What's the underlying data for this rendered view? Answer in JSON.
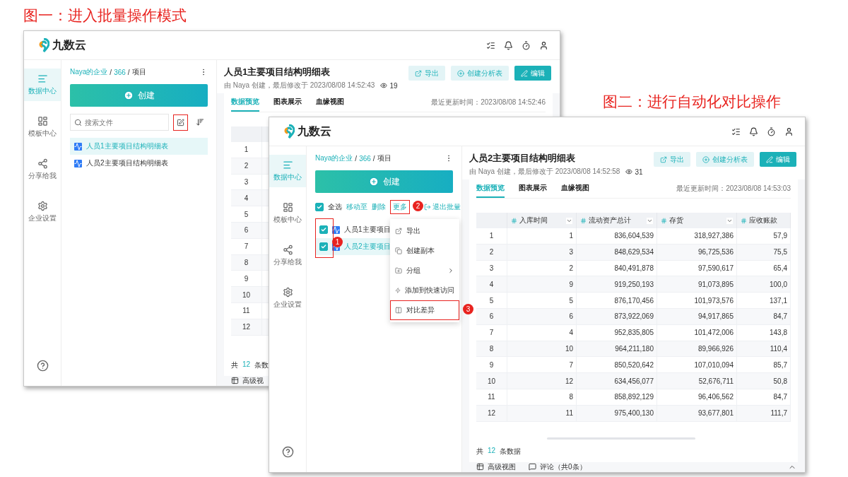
{
  "captions": [
    {
      "text": "图一：进入批量操作模式"
    },
    {
      "text": "图二：进行自动化对比操作"
    }
  ],
  "windows": [
    {
      "logo": "九数云",
      "nav": [
        {
          "label": "数据中心",
          "selected": true
        },
        {
          "label": "模板中心",
          "selected": false
        },
        {
          "label": "分享给我",
          "selected": false
        },
        {
          "label": "企业设置",
          "selected": false
        }
      ],
      "breadcrumb": [
        {
          "text": "Naya的企业",
          "kind": "link"
        },
        {
          "text": "/",
          "kind": "separator"
        },
        {
          "text": "366",
          "kind": "link"
        },
        {
          "text": "/",
          "kind": "separator"
        },
        {
          "text": "项目",
          "kind": "current"
        }
      ],
      "create": "创建",
      "toolbar": {
        "kind": "search",
        "placeholder": "搜索文件",
        "batch_highlighted": true
      },
      "files": [
        {
          "name": "人员1主要项目结构明细表",
          "selected": true
        },
        {
          "name": "人员2主要项目结构明细表",
          "selected": false
        }
      ],
      "doc": {
        "title": "人员1主要项目结构明细表",
        "meta": "由 Naya 创建，最后修改于 2023/08/08 14:52:43",
        "views": "19",
        "buttons": [
          "导出",
          "创建分析表",
          "编辑"
        ],
        "tabs": [
          {
            "label": "数据预览",
            "selected": true
          },
          {
            "label": "图表展示",
            "selected": false
          },
          {
            "label": "血缘视图",
            "selected": false
          }
        ],
        "updated": "最近更新时间：2023/08/08 14:52:46",
        "table": {
          "rows": [
            [
              "1"
            ],
            [
              "2"
            ],
            [
              "3"
            ],
            [
              "4"
            ],
            [
              "5"
            ],
            [
              "6"
            ],
            [
              "7"
            ],
            [
              "8"
            ],
            [
              "9"
            ],
            [
              "10"
            ],
            [
              "11"
            ],
            [
              "12"
            ]
          ]
        },
        "total": [
          "共",
          "12",
          "条数"
        ],
        "bottom": [
          "高级视"
        ]
      }
    },
    {
      "logo": "九数云",
      "nav": [
        {
          "label": "数据中心",
          "selected": true
        },
        {
          "label": "模板中心",
          "selected": false
        },
        {
          "label": "分享给我",
          "selected": false
        },
        {
          "label": "企业设置",
          "selected": false
        }
      ],
      "breadcrumb": [
        {
          "text": "Naya的企业",
          "kind": "link"
        },
        {
          "text": "/",
          "kind": "separator"
        },
        {
          "text": "366",
          "kind": "link"
        },
        {
          "text": "/",
          "kind": "separator"
        },
        {
          "text": "项目",
          "kind": "current"
        }
      ],
      "create": "创建",
      "toolbar": {
        "kind": "batch",
        "select_all": {
          "label": "全选",
          "checked": true
        },
        "actions": [
          {
            "label": "移动至"
          },
          {
            "label": "删除"
          },
          {
            "label": "更多",
            "badge": "2"
          }
        ],
        "exit": "退出批量",
        "menu": [
          {
            "label": "导出",
            "submenu": false
          },
          {
            "label": "创建副本",
            "submenu": false
          },
          {
            "label": "分组",
            "submenu": true
          },
          {
            "label": "添加到快速访问",
            "submenu": false
          },
          {
            "label": "对比差异",
            "submenu": false,
            "badge": "3"
          }
        ]
      },
      "checkbox_badge": "1",
      "files": [
        {
          "name": "人员1主要项目",
          "selected": false,
          "checked": true
        },
        {
          "name": "人员2主要项目",
          "selected": true,
          "checked": true
        }
      ],
      "doc": {
        "title": "人员2主要项目结构明细表",
        "meta": "由 Naya 创建，最后修改于 2023/08/08 14:52:58",
        "views": "31",
        "buttons": [
          "导出",
          "创建分析表",
          "编辑"
        ],
        "tabs": [
          {
            "label": "数据预览",
            "selected": true
          },
          {
            "label": "图表展示",
            "selected": false
          },
          {
            "label": "血缘视图",
            "selected": false
          }
        ],
        "updated": "最近更新时间：2023/08/08 14:53:03",
        "table": {
          "columns": [
            {
              "label": "入库时间",
              "menu": true
            },
            {
              "label": "流动资产总计",
              "menu": true
            },
            {
              "label": "存货",
              "menu": true
            },
            {
              "label": "应收账款",
              "menu": false
            }
          ],
          "rows": [
            [
              "1",
              "1",
              "836,604,539",
              "318,927,386",
              "57,9"
            ],
            [
              "2",
              "3",
              "848,629,534",
              "96,725,536",
              "75,5"
            ],
            [
              "3",
              "2",
              "840,491,878",
              "97,590,617",
              "65,4"
            ],
            [
              "4",
              "9",
              "919,250,193",
              "91,073,895",
              "100,0"
            ],
            [
              "5",
              "5",
              "876,170,456",
              "101,973,576",
              "137,1"
            ],
            [
              "6",
              "6",
              "873,922,069",
              "94,917,865",
              "84,7"
            ],
            [
              "7",
              "4",
              "952,835,805",
              "101,472,006",
              "143,8"
            ],
            [
              "8",
              "10",
              "964,211,180",
              "89,966,926",
              "110,4"
            ],
            [
              "9",
              "7",
              "850,520,642",
              "107,010,094",
              "85,7"
            ],
            [
              "10",
              "12",
              "634,456,077",
              "52,676,711",
              "50,8"
            ],
            [
              "11",
              "8",
              "858,892,129",
              "96,406,562",
              "84,7"
            ],
            [
              "12",
              "11",
              "975,400,130",
              "93,677,801",
              "111,7"
            ]
          ]
        },
        "total": [
          "共",
          "12",
          "条数据"
        ],
        "bottom": [
          "高级视图",
          "评论（共0条）"
        ]
      }
    }
  ]
}
